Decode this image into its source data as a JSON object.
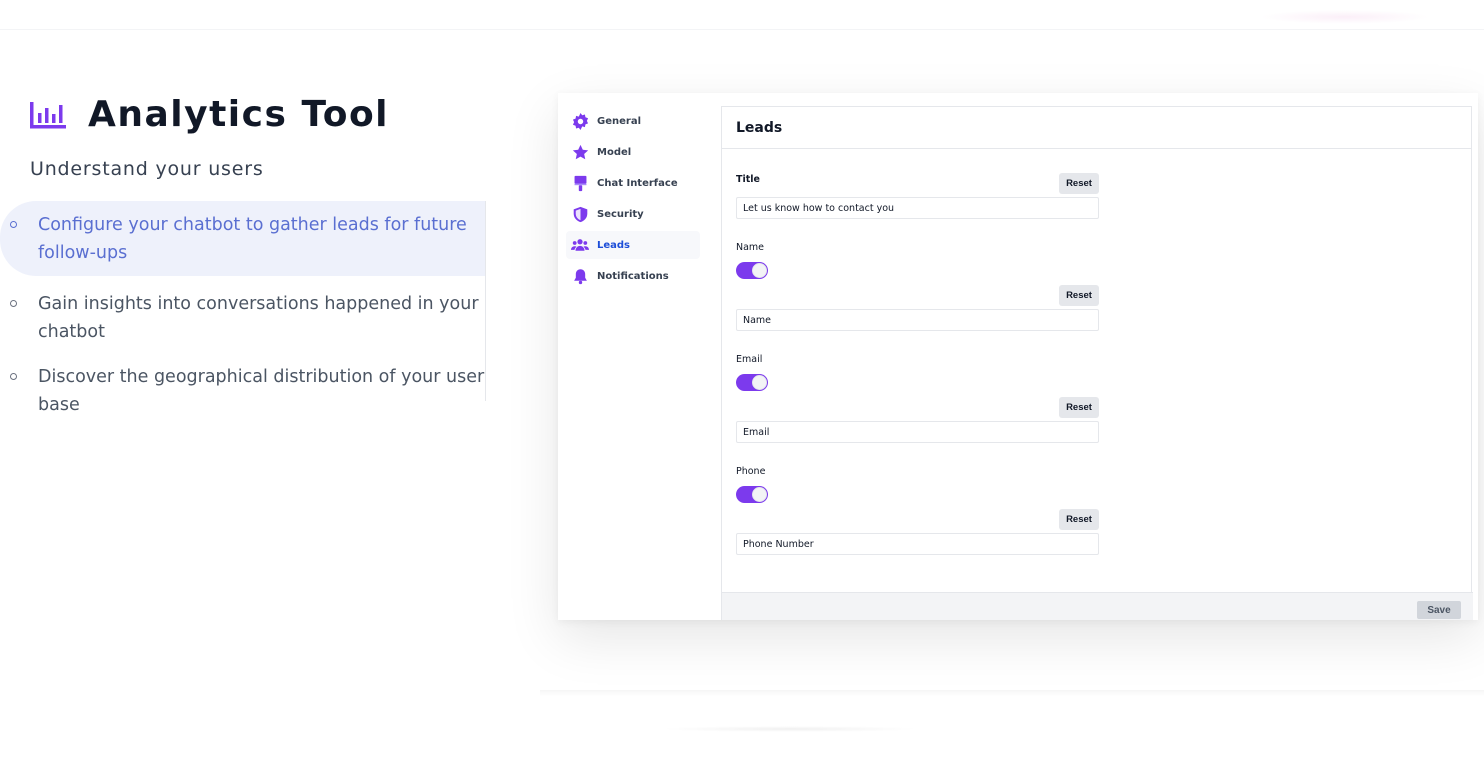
{
  "hero": {
    "icon": "bar-chart-icon",
    "title": "Analytics Tool",
    "subtitle": "Understand your users"
  },
  "features": [
    {
      "text": "Configure your chatbot to gather leads for future follow-ups",
      "active": true
    },
    {
      "text": "Gain insights into conversations happened in your chatbot",
      "active": false
    },
    {
      "text": "Discover the geographical distribution of your user base",
      "active": false
    }
  ],
  "app": {
    "nav": [
      {
        "label": "General",
        "icon": "gear-icon"
      },
      {
        "label": "Model",
        "icon": "star-icon"
      },
      {
        "label": "Chat Interface",
        "icon": "paint-brush-icon"
      },
      {
        "label": "Security",
        "icon": "shield-icon"
      },
      {
        "label": "Leads",
        "icon": "users-icon",
        "active": true
      },
      {
        "label": "Notifications",
        "icon": "bell-icon"
      }
    ],
    "header": {
      "title": "Leads"
    },
    "fields": {
      "title": {
        "label": "Title",
        "value": "Let us know how to contact you",
        "reset": "Reset"
      },
      "name": {
        "label": "Name",
        "value": "Name",
        "reset": "Reset",
        "enabled": true
      },
      "email": {
        "label": "Email",
        "value": "Email",
        "reset": "Reset",
        "enabled": true
      },
      "phone": {
        "label": "Phone",
        "value": "Phone Number",
        "reset": "Reset",
        "enabled": true
      }
    },
    "footer": {
      "save_label": "Save"
    },
    "colors": {
      "accent": "#7c3aed",
      "active_link": "#1d4ed8",
      "feature_active": "#5a6fd1"
    }
  }
}
